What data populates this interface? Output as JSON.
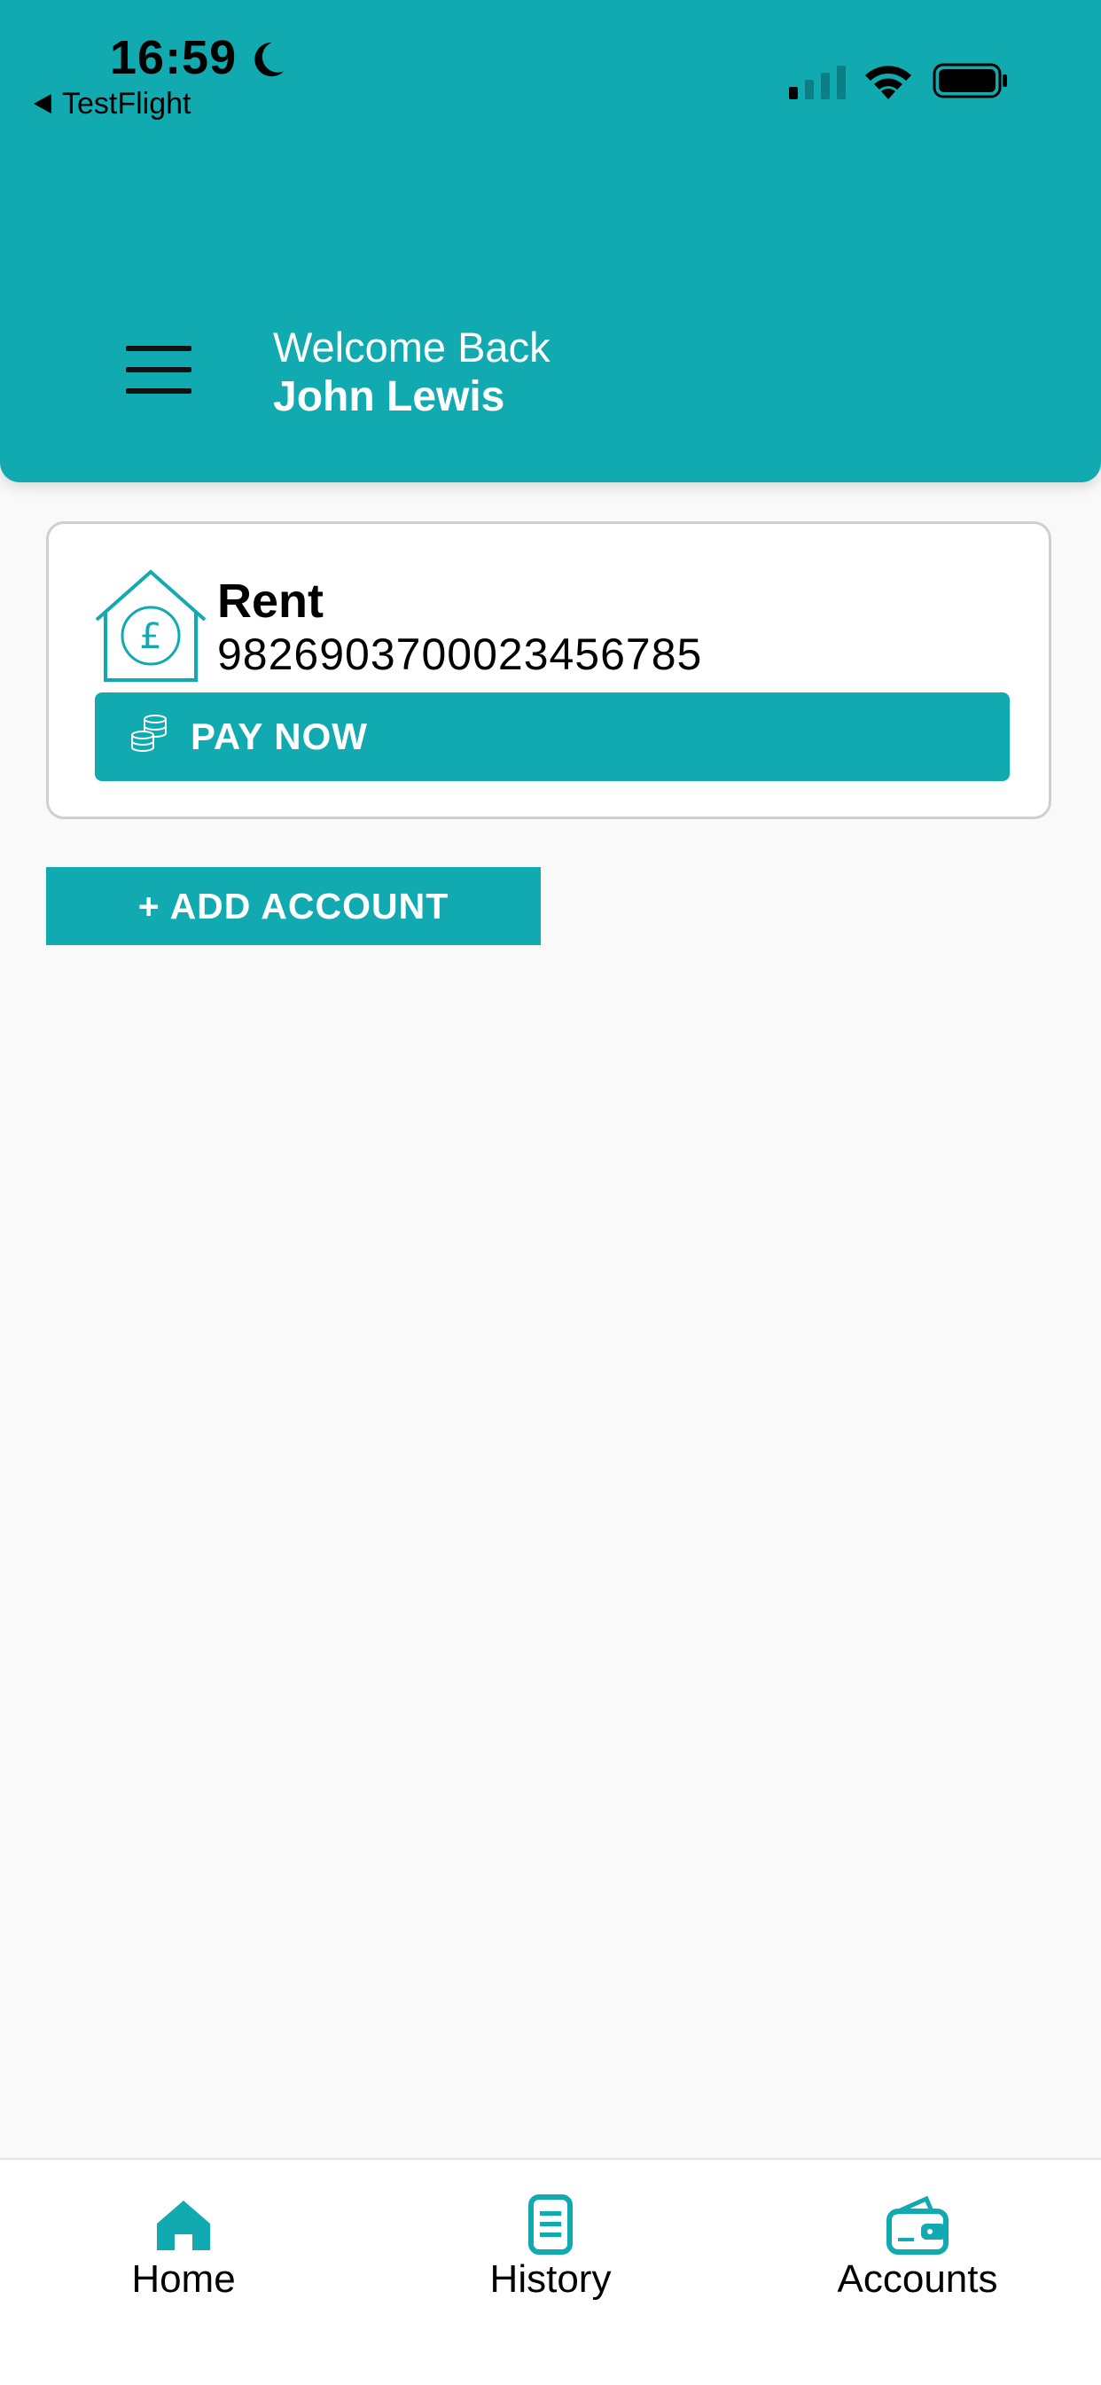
{
  "status_bar": {
    "time": "16:59",
    "back_app": "TestFlight"
  },
  "header": {
    "welcome_text": "Welcome Back",
    "user_name": "John Lewis"
  },
  "account_card": {
    "name": "Rent",
    "number": "98269037000234567​85",
    "pay_button_label": "PAY NOW"
  },
  "add_account_label": "+ ADD ACCOUNT",
  "tabbar": {
    "items": [
      {
        "label": "Home",
        "icon": "home-icon"
      },
      {
        "label": "History",
        "icon": "history-icon"
      },
      {
        "label": "Accounts",
        "icon": "wallet-icon"
      }
    ]
  },
  "colors": {
    "accent": "#11aab0",
    "background": "#f9f9f9"
  }
}
